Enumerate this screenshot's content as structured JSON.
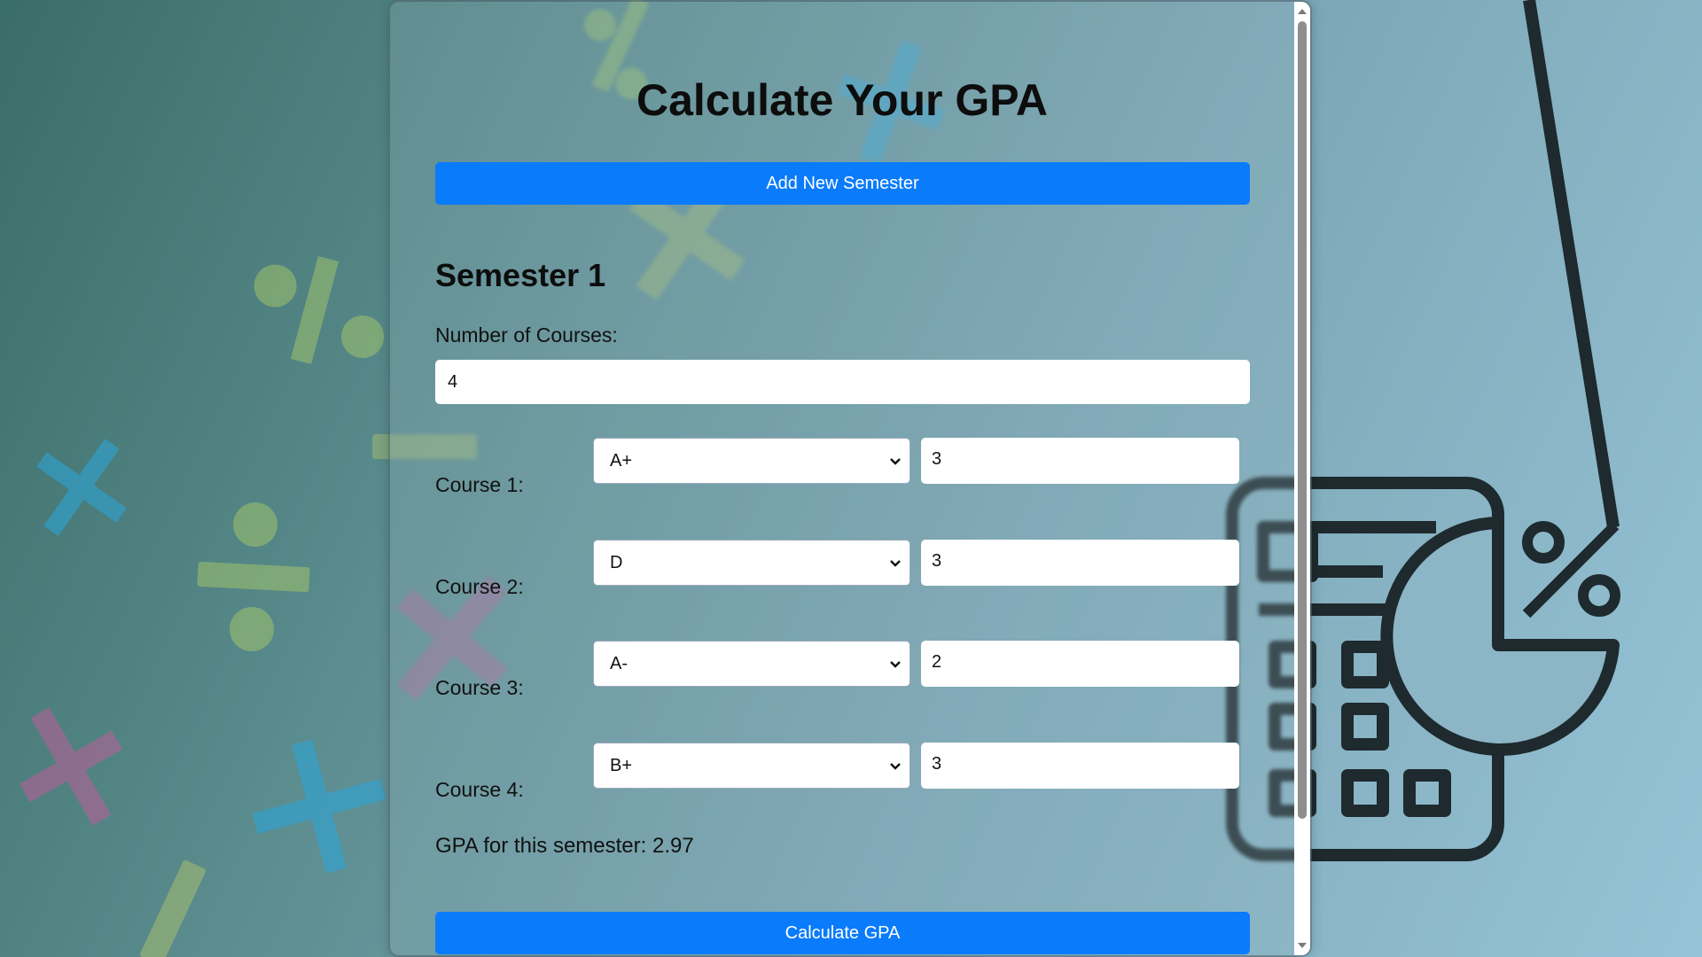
{
  "page": {
    "title": "Calculate Your GPA",
    "add_semester_label": "Add New Semester",
    "calculate_label": "Calculate GPA"
  },
  "semester": {
    "title": "Semester 1",
    "num_courses_label": "Number of Courses:",
    "num_courses_value": "4",
    "courses": [
      {
        "label": "Course 1:",
        "grade": "A+",
        "credits": "3"
      },
      {
        "label": "Course 2:",
        "grade": "D",
        "credits": "3"
      },
      {
        "label": "Course 3:",
        "grade": "A-",
        "credits": "2"
      },
      {
        "label": "Course 4:",
        "grade": "B+",
        "credits": "3"
      }
    ],
    "gpa_text": "GPA for this semester: 2.97"
  },
  "colors": {
    "primary_button": "#0a7bfb",
    "text": "#0d0d0d"
  },
  "icons": {
    "background_decor": [
      "percent-icon",
      "multiply-icon",
      "divide-icon",
      "plus-icon",
      "minus-icon"
    ],
    "calculator_illustration": "calculator-percent-icon"
  }
}
